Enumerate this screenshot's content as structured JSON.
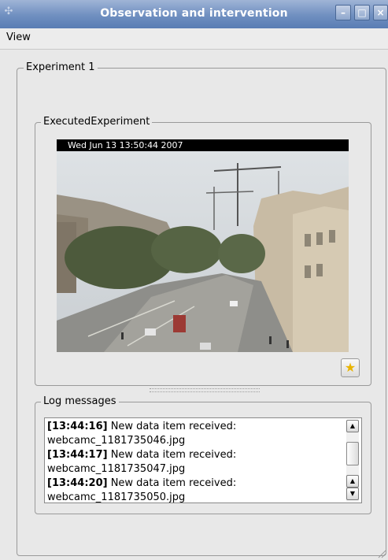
{
  "window": {
    "title": "Observation and intervention",
    "icon": "app-icon",
    "controls": {
      "minimize": "–",
      "maximize": "□",
      "close": "×"
    }
  },
  "menubar": {
    "items": [
      "View"
    ]
  },
  "experiment_group": {
    "title": "Experiment 1"
  },
  "executed_group": {
    "title": "ExecutedExperiment"
  },
  "camera": {
    "timestamp": "Wed Jun 13  13:50:44  2007",
    "description": "webcam street view"
  },
  "star_button": {
    "icon": "star-icon",
    "glyph": "★"
  },
  "log_group": {
    "title": "Log messages"
  },
  "log": {
    "lines": [
      {
        "time": "[13:44:16]",
        "text": " New data item received:"
      },
      {
        "time": "",
        "text": "webcamc_1181735046.jpg"
      },
      {
        "time": "[13:44:17]",
        "text": " New data item received:"
      },
      {
        "time": "",
        "text": "webcamc_1181735047.jpg"
      },
      {
        "time": "[13:44:20]",
        "text": " New data item received:"
      },
      {
        "time": "",
        "text": "webcamc_1181735050.jpg"
      }
    ]
  },
  "scrollbar": {
    "up_glyph": "▲",
    "down_glyph": "▼"
  }
}
